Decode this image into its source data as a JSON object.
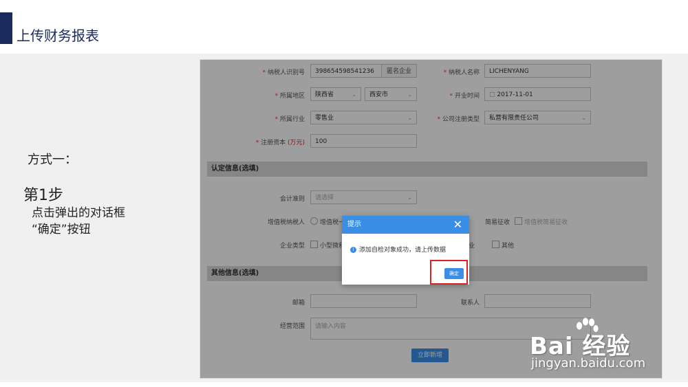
{
  "page": {
    "title": "上传财务报表"
  },
  "notes": {
    "method": "方式一：",
    "step": "第1步",
    "line1": "点击弹出的对话框",
    "line2": "“确定”按钮"
  },
  "form": {
    "taxpayer_id": {
      "label": "纳税人识别号",
      "value": "398654598541236",
      "addon": "匿名企业"
    },
    "taxpayer_name": {
      "label": "纳税人名称",
      "value": "LICHENYANG"
    },
    "region": {
      "label": "所属地区",
      "province": "陕西省",
      "city": "西安市"
    },
    "open_date": {
      "label": "开业时间",
      "value": "2017-11-01"
    },
    "industry": {
      "label": "所属行业",
      "value": "零售业"
    },
    "reg_type": {
      "label": "公司注册类型",
      "value": "私营有限责任公司"
    },
    "capital": {
      "label": "注册资本",
      "unit": "(万元)",
      "value": "100"
    },
    "section_cert": "认定信息(选填)",
    "accounting": {
      "label": "会计准则",
      "placeholder": "请选择"
    },
    "vat": {
      "label": "增值税纳税人",
      "option1": "增值税一"
    },
    "simple_levy": {
      "label": "简易征收",
      "option": "增值税简易征收"
    },
    "company_type": {
      "label": "企业类型",
      "option1": "小型微利",
      "option_tail": "业",
      "option_other": "其他"
    },
    "section_other": "其他信息(选填)",
    "email": {
      "label": "邮箱"
    },
    "contact": {
      "label": "联系人"
    },
    "scope": {
      "label": "经营范围",
      "placeholder": "请输入内容"
    },
    "submit": "立即新增"
  },
  "dialog": {
    "title": "提示",
    "message": "添加自检对象成功，请上传数据",
    "ok": "确定"
  },
  "watermark": {
    "brand": "Bai 经验",
    "url": "jingyan.baidu.com"
  },
  "colors": {
    "accent": "#3a8ee6",
    "title": "#1a2a5c",
    "highlight": "#e02020"
  }
}
